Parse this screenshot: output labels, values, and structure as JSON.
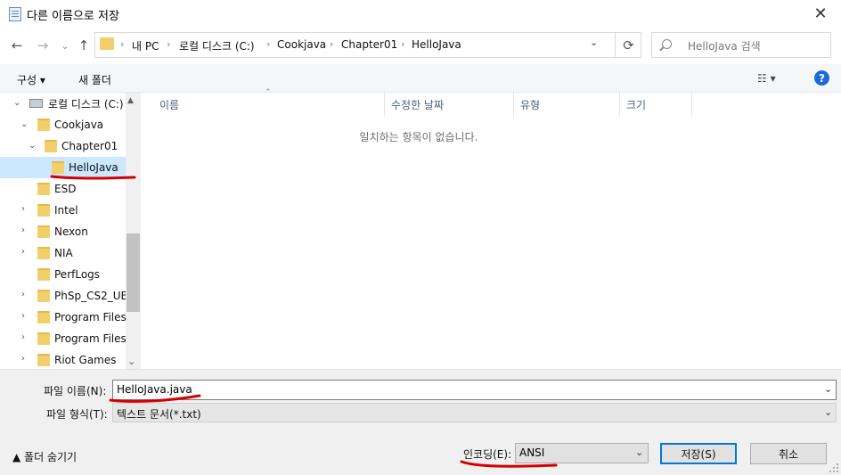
{
  "window": {
    "title": "다른 이름으로 저장",
    "close_symbol": "✕"
  },
  "address": {
    "back_symbol": "←",
    "forward_symbol": "→",
    "recent_symbol": "⌄",
    "up_symbol": "↑",
    "breadcrumbs": [
      "내 PC",
      "로컬 디스크 (C:)",
      "Cookjava",
      "Chapter01",
      "HelloJava"
    ],
    "separator": "›",
    "dropdown_symbol": "⌄",
    "refresh_symbol": "⟳",
    "search_placeholder": "HelloJava 검색"
  },
  "toolbar": {
    "organize_label": "구성 ▾",
    "new_folder_label": "새 폴더",
    "view_label": "☷ ▾",
    "help_label": "?"
  },
  "nav": {
    "items": [
      {
        "label": "로컬 디스크 (C:)",
        "arrow": "⌄",
        "type": "drive"
      },
      {
        "label": "Cookjava",
        "arrow": "⌄"
      },
      {
        "label": "Chapter01",
        "arrow": "⌄"
      },
      {
        "label": "HelloJava",
        "arrow": ""
      },
      {
        "label": "ESD",
        "arrow": ""
      },
      {
        "label": "Intel",
        "arrow": "›"
      },
      {
        "label": "Nexon",
        "arrow": "›"
      },
      {
        "label": "NIA",
        "arrow": "›"
      },
      {
        "label": "PerfLogs",
        "arrow": ""
      },
      {
        "label": "PhSp_CS2_UE_",
        "arrow": "›"
      },
      {
        "label": "Program Files",
        "arrow": "›"
      },
      {
        "label": "Program Files",
        "arrow": "›"
      },
      {
        "label": "Riot Games",
        "arrow": "›"
      }
    ],
    "scroll_up": "▲",
    "scroll_down": "⌄"
  },
  "list": {
    "columns": [
      "이름",
      "수정한 날짜",
      "유형",
      "크기"
    ],
    "sort_caret": "⌃",
    "empty_message": "일치하는 항목이 없습니다."
  },
  "form": {
    "filename_label": "파일 이름(N):",
    "filename_value": "HelloJava.java",
    "filetype_label": "파일 형식(T):",
    "filetype_value": "텍스트 문서(*.txt)",
    "dropdown_symbol": "⌄",
    "hide_folders_label": "▲  폴더 숨기기",
    "encoding_label": "인코딩(E):",
    "encoding_value": "ANSI",
    "save_label": "저장(S)",
    "cancel_label": "취소"
  },
  "colors": {
    "selection": "#cce8ff",
    "folder": "#f3cf6b",
    "accent": "#0078d7",
    "annotation": "#d40000"
  }
}
